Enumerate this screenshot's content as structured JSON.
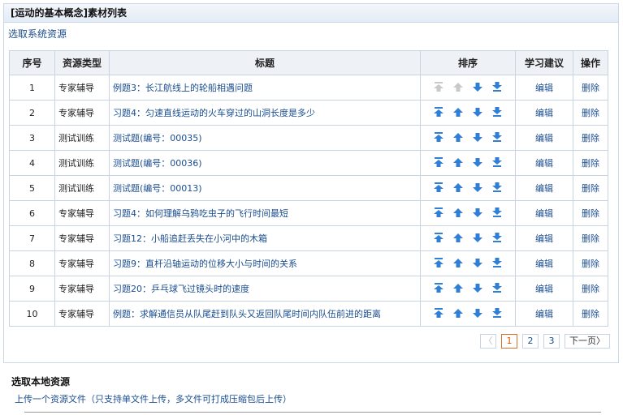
{
  "panel": {
    "title": "[运动的基本概念]素材列表"
  },
  "system_link": "选取系统资源",
  "table": {
    "headers": [
      "序号",
      "资源类型",
      "标题",
      "排序",
      "学习建议",
      "操作"
    ],
    "rows": [
      {
        "no": "1",
        "type": "专家辅导",
        "title": "例题3：长江航线上的轮船相遇问题",
        "edit": "编辑",
        "del": "删除",
        "first": true
      },
      {
        "no": "2",
        "type": "专家辅导",
        "title": "习题4：匀速直线运动的火车穿过的山洞长度是多少",
        "edit": "编辑",
        "del": "删除"
      },
      {
        "no": "3",
        "type": "测试训练",
        "title": "测试题(编号：00035)",
        "edit": "编辑",
        "del": "删除"
      },
      {
        "no": "4",
        "type": "测试训练",
        "title": "测试题(编号：00036)",
        "edit": "编辑",
        "del": "删除"
      },
      {
        "no": "5",
        "type": "测试训练",
        "title": "测试题(编号：00013)",
        "edit": "编辑",
        "del": "删除"
      },
      {
        "no": "6",
        "type": "专家辅导",
        "title": "习题4：如何理解乌鸦吃虫子的飞行时间最短",
        "edit": "编辑",
        "del": "删除"
      },
      {
        "no": "7",
        "type": "专家辅导",
        "title": "习题12：小船追赶丢失在小河中的木箱",
        "edit": "编辑",
        "del": "删除"
      },
      {
        "no": "8",
        "type": "专家辅导",
        "title": "习题9：直杆沿轴运动的位移大小与时间的关系",
        "edit": "编辑",
        "del": "删除"
      },
      {
        "no": "9",
        "type": "专家辅导",
        "title": "习题20：乒乓球飞过镜头时的速度",
        "edit": "编辑",
        "del": "删除"
      },
      {
        "no": "10",
        "type": "专家辅导",
        "title": "例题：求解通信员从队尾赶到队头又返回队尾时间内队伍前进的距离",
        "edit": "编辑",
        "del": "删除"
      }
    ]
  },
  "pager": {
    "prev": "〈",
    "pages": [
      "1",
      "2",
      "3"
    ],
    "current": "1",
    "next": "下一页〉"
  },
  "local": {
    "title": "选取本地资源",
    "upload_link": "上传一个资源文件（只支持单文件上传，多文件可打成压缩包后上传）"
  },
  "colors": {
    "link": "#1a4d8f",
    "arrow_active": "#2f7fd6",
    "arrow_disabled": "#c9c9c9",
    "current_page": "#e05000"
  }
}
